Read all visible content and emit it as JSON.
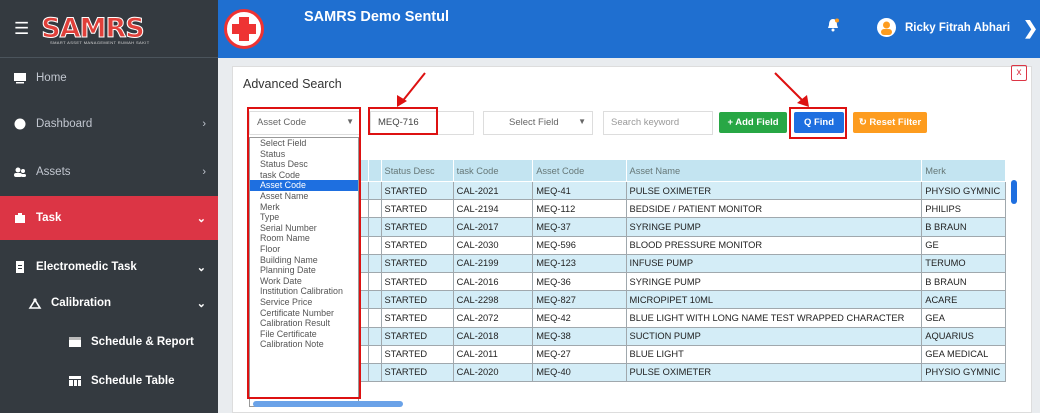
{
  "sidebar": {
    "brand": "SAMRS",
    "brand_tagline": "SMART ASSET MANAGEMENT RUMAH SAKIT",
    "items": [
      {
        "label": "Home"
      },
      {
        "label": "Dashboard"
      },
      {
        "label": "Assets"
      },
      {
        "label": "Task"
      },
      {
        "label": "Electromedic Task"
      },
      {
        "label": "Calibration"
      },
      {
        "label": "Schedule & Report"
      },
      {
        "label": "Schedule Table"
      }
    ]
  },
  "header": {
    "title": "SAMRS Demo Sentul",
    "user_name": "Ricky Fitrah Abhari"
  },
  "search": {
    "title": "Advanced Search",
    "close": "x",
    "field_select": "Asset Code",
    "value": "MEQ-716",
    "field_select_2": "Select Field",
    "keyword_placeholder": "Search keyword",
    "add_field": "+ Add Field",
    "find": "Q Find",
    "reset": "Reset Filter"
  },
  "dropdown_options": [
    "Select Field",
    "Status",
    "Status Desc",
    "task Code",
    "Asset Code",
    "Asset Name",
    "Merk",
    "Type",
    "Serial Number",
    "Room Name",
    "Floor",
    "Building Name",
    "Planning Date",
    "Work Date",
    "Institution Calibration",
    "Service Price",
    "Certificate Number",
    "Calibration Result",
    "File Certificate",
    "Calibration Note"
  ],
  "dropdown_selected": "Asset Code",
  "table": {
    "headers": [
      "Status Desc",
      "task Code",
      "Asset Code",
      "Asset Name",
      "Merk"
    ],
    "rows": [
      [
        "STARTED",
        "CAL-2021",
        "MEQ-41",
        "PULSE OXIMETER",
        "PHYSIO GYMNIC"
      ],
      [
        "STARTED",
        "CAL-2194",
        "MEQ-112",
        "BEDSIDE / PATIENT MONITOR",
        "PHILIPS"
      ],
      [
        "STARTED",
        "CAL-2017",
        "MEQ-37",
        "SYRINGE PUMP",
        "B BRAUN"
      ],
      [
        "STARTED",
        "CAL-2030",
        "MEQ-596",
        "BLOOD PRESSURE MONITOR",
        "GE"
      ],
      [
        "STARTED",
        "CAL-2199",
        "MEQ-123",
        "INFUSE PUMP",
        "TERUMO"
      ],
      [
        "STARTED",
        "CAL-2016",
        "MEQ-36",
        "SYRINGE PUMP",
        "B BRAUN"
      ],
      [
        "STARTED",
        "CAL-2298",
        "MEQ-827",
        "MICROPIPET 10ML",
        "ACARE"
      ],
      [
        "STARTED",
        "CAL-2072",
        "MEQ-42",
        "BLUE LIGHT WITH LONG NAME TEST WRAPPED CHARACTER",
        "GEA"
      ],
      [
        "STARTED",
        "CAL-2018",
        "MEQ-38",
        "SUCTION PUMP",
        "AQUARIUS"
      ],
      [
        "STARTED",
        "CAL-2011",
        "MEQ-27",
        "BLUE LIGHT",
        "GEA MEDICAL"
      ],
      [
        "STARTED",
        "CAL-2020",
        "MEQ-40",
        "PULSE OXIMETER",
        "PHYSIO GYMNIC"
      ]
    ]
  },
  "colors": {
    "sidebar": "#343a40",
    "header": "#1f6fd0",
    "active": "#dc3545",
    "add": "#28a745",
    "find": "#1e6fe0",
    "reset": "#fd9c1f"
  }
}
